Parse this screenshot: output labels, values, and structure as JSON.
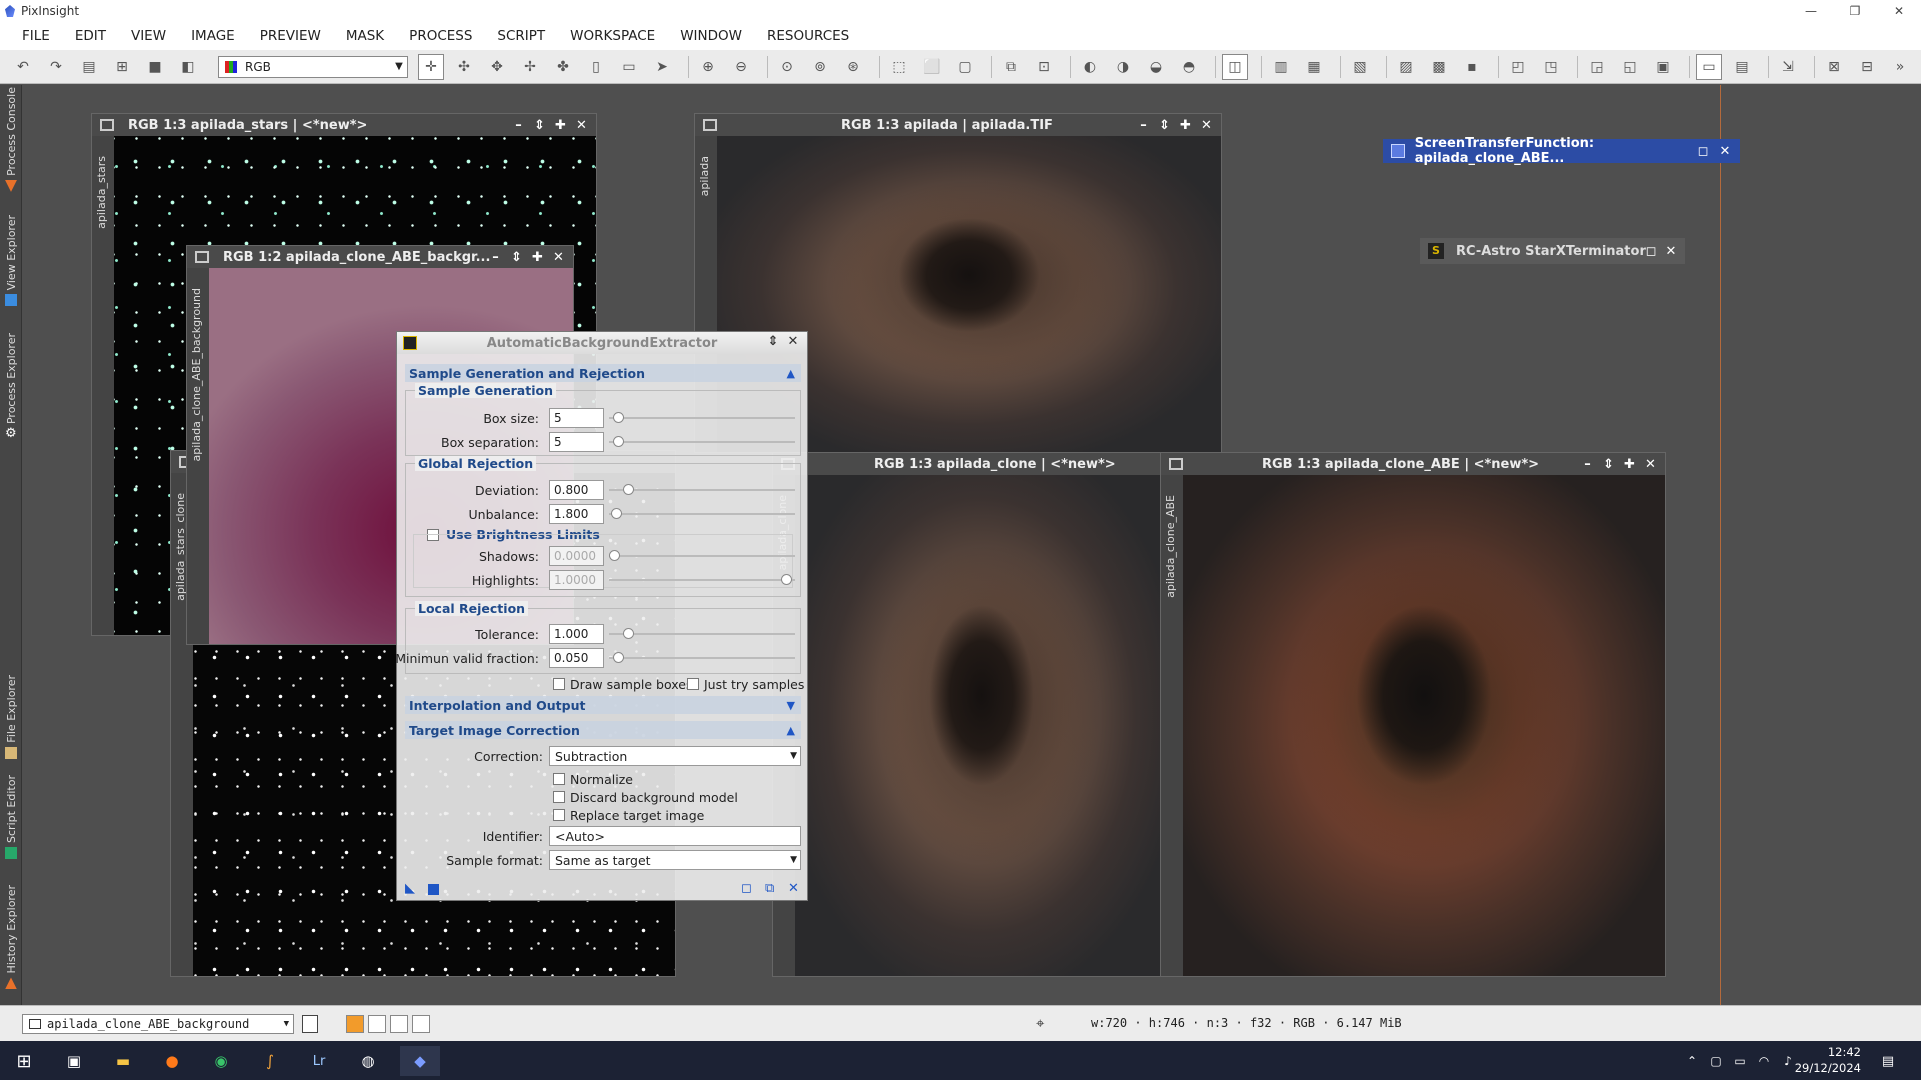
{
  "app": {
    "title": "PixInsight",
    "window_controls": [
      "—",
      "❐",
      "✕"
    ]
  },
  "menu": [
    "FILE",
    "EDIT",
    "VIEW",
    "IMAGE",
    "PREVIEW",
    "MASK",
    "PROCESS",
    "SCRIPT",
    "WORKSPACE",
    "WINDOW",
    "RESOURCES"
  ],
  "toolbar": {
    "channel_select": "RGB"
  },
  "left_dock": [
    "Process Console",
    "View Explorer",
    "Process Explorer",
    "File Explorer",
    "Script Editor",
    "History Explorer"
  ],
  "windows": {
    "stars": {
      "title": "RGB 1:3 apilada_stars | <*new*>",
      "side": "apilada_stars"
    },
    "stars_clone": {
      "side": "apilada_stars_clone"
    },
    "background": {
      "title": "RGB 1:2 apilada_clone_ABE_backgr...",
      "side": "apilada_clone_ABE_background"
    },
    "tif": {
      "title": "RGB 1:3 apilada | apilada.TIF",
      "side": "apilada"
    },
    "clone": {
      "title": "RGB 1:3 apilada_clone | <*new*>",
      "side": "apilada_clone"
    },
    "abe_result": {
      "title": "RGB 1:3 apilada_clone_ABE | <*new*>",
      "side": "apilada_clone_ABE"
    }
  },
  "abe": {
    "title": "AutomaticBackgroundExtractor",
    "section_sample": "Sample Generation and Rejection",
    "group_sample_generation": "Sample Generation",
    "box_size": {
      "label": "Box size:",
      "value": "5"
    },
    "box_separation": {
      "label": "Box separation:",
      "value": "5"
    },
    "group_global_rejection": "Global Rejection",
    "deviation": {
      "label": "Deviation:",
      "value": "0.800"
    },
    "unbalance": {
      "label": "Unbalance:",
      "value": "1.800"
    },
    "use_brightness_limits": "Use Brightness Limits",
    "shadows": {
      "label": "Shadows:",
      "value": "0.0000"
    },
    "highlights": {
      "label": "Highlights:",
      "value": "1.0000"
    },
    "group_local_rejection": "Local Rejection",
    "tolerance": {
      "label": "Tolerance:",
      "value": "1.000"
    },
    "min_valid_fraction": {
      "label": "Minimun valid fraction:",
      "value": "0.050"
    },
    "draw_sample_boxes": "Draw sample boxes",
    "just_try_samples": "Just try samples",
    "section_interp": "Interpolation and Output",
    "section_target": "Target Image Correction",
    "correction": {
      "label": "Correction:",
      "value": "Subtraction"
    },
    "normalize": "Normalize",
    "discard_bg": "Discard background model",
    "replace_target": "Replace target image",
    "identifier": {
      "label": "Identifier:",
      "value": "<Auto>"
    },
    "sample_format": {
      "label": "Sample format:",
      "value": "Same as target"
    }
  },
  "floating": {
    "stf": "ScreenTransferFunction: apilada_clone_ABE...",
    "sxt": "RC-Astro StarXTerminator",
    "sxt_icon": "S"
  },
  "status": {
    "view": "apilada_clone_ABE_background",
    "info": "w:720 · h:746 · n:3 · f32 · RGB · 6.147 MiB"
  },
  "taskbar": {
    "time": "12:42",
    "date": "29/12/2024"
  },
  "colors": {
    "accent_blue": "#2c4ca5",
    "section_text": "#204a8a",
    "dock_line": "#b46a3c"
  }
}
